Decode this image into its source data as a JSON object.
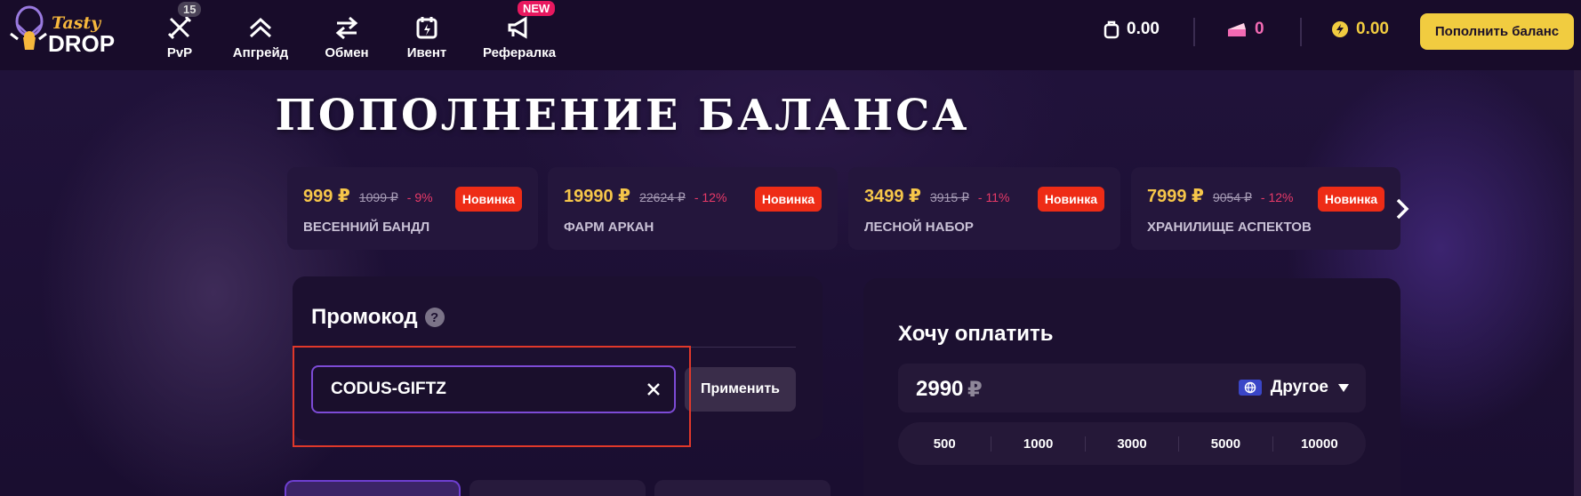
{
  "header": {
    "logo_text_top": "Tasty",
    "logo_text_bottom": "DROP",
    "nav": [
      {
        "label": "PvP",
        "badge": "15"
      },
      {
        "label": "Апгрейд"
      },
      {
        "label": "Обмен"
      },
      {
        "label": "Ивент"
      },
      {
        "label": "Рефералка",
        "badge": "NEW"
      }
    ],
    "balance": "0.00",
    "cake_count": "0",
    "coins": "0.00",
    "topup_label": "Пополнить баланс"
  },
  "page_title": "ПОПОЛНЕНИЕ БАЛАНСА",
  "offers": [
    {
      "price": "999 ₽",
      "old_price": "1099 ₽",
      "discount": "- 9%",
      "name": "ВЕСЕННИЙ БАНДЛ",
      "badge": "Новинка"
    },
    {
      "price": "19990 ₽",
      "old_price": "22624 ₽",
      "discount": "- 12%",
      "name": "ФАРМ АРКАН",
      "badge": "Новинка"
    },
    {
      "price": "3499 ₽",
      "old_price": "3915 ₽",
      "discount": "- 11%",
      "name": "ЛЕСНОЙ НАБОР",
      "badge": "Новинка"
    },
    {
      "price": "7999 ₽",
      "old_price": "9054 ₽",
      "discount": "- 12%",
      "name": "ХРАНИЛИЩЕ АСПЕКТОВ",
      "badge": "Новинка"
    }
  ],
  "promo": {
    "title": "Промокод",
    "help": "?",
    "value": "CODUS-GIFTZ",
    "apply_label": "Применить"
  },
  "pay": {
    "title": "Хочу оплатить",
    "amount": "2990",
    "currency_symbol": "₽",
    "method": "Другое",
    "presets": [
      "500",
      "1000",
      "3000",
      "5000",
      "10000"
    ]
  },
  "colors": {
    "accent_yellow": "#f1cc40",
    "badge_red": "#ee2c16",
    "discount_pink": "#e83a68",
    "input_border": "#7d4bd6",
    "highlight": "#e0382a"
  }
}
